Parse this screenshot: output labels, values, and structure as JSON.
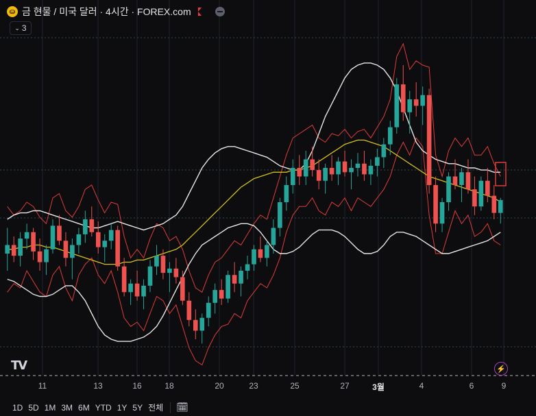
{
  "header": {
    "symbol_icon": "gold-coin-icon",
    "title": "금 현물 / 미국 달러 · 4시간 · FOREX.com",
    "indicator_count": "3"
  },
  "colors": {
    "background": "#0d0d0f",
    "up": "#26a69a",
    "down": "#ef5350",
    "bollinger": "#e8e8e8",
    "ma": "#d4c21c",
    "envelope": "#e03c3c",
    "grid": "#1f2330"
  },
  "x_axis_labels": [
    "11",
    "13",
    "16",
    "18",
    "20",
    "23",
    "25",
    "27",
    "3월",
    "4",
    "6",
    "9"
  ],
  "range_buttons": [
    "1D",
    "5D",
    "1M",
    "3M",
    "6M",
    "YTD",
    "1Y",
    "5Y",
    "전체"
  ],
  "icons": {
    "tradingview": "tradingview-logo-icon",
    "bolt": "lightning-icon",
    "calendar": "calendar-range-icon"
  },
  "chart_data": {
    "type": "candlestick",
    "candles": [
      [
        48,
        60,
        40,
        52
      ],
      [
        52,
        56,
        44,
        47
      ],
      [
        47,
        58,
        42,
        55
      ],
      [
        55,
        62,
        50,
        58
      ],
      [
        58,
        60,
        45,
        49
      ],
      [
        49,
        55,
        40,
        44
      ],
      [
        44,
        52,
        38,
        50
      ],
      [
        50,
        64,
        48,
        61
      ],
      [
        61,
        66,
        52,
        54
      ],
      [
        54,
        58,
        42,
        46
      ],
      [
        46,
        55,
        36,
        52
      ],
      [
        52,
        60,
        48,
        57
      ],
      [
        57,
        68,
        53,
        64
      ],
      [
        64,
        70,
        56,
        58
      ],
      [
        58,
        63,
        48,
        51
      ],
      [
        51,
        57,
        44,
        54
      ],
      [
        54,
        62,
        50,
        59
      ],
      [
        59,
        61,
        40,
        42
      ],
      [
        42,
        46,
        28,
        30
      ],
      [
        30,
        36,
        24,
        34
      ],
      [
        34,
        40,
        26,
        28
      ],
      [
        28,
        36,
        22,
        33
      ],
      [
        33,
        45,
        30,
        42
      ],
      [
        42,
        52,
        38,
        47
      ],
      [
        47,
        50,
        36,
        39
      ],
      [
        39,
        44,
        30,
        41
      ],
      [
        41,
        46,
        34,
        37
      ],
      [
        37,
        40,
        24,
        26
      ],
      [
        26,
        30,
        14,
        17
      ],
      [
        17,
        22,
        8,
        12
      ],
      [
        12,
        20,
        6,
        18
      ],
      [
        18,
        28,
        14,
        25
      ],
      [
        25,
        34,
        20,
        31
      ],
      [
        31,
        36,
        24,
        27
      ],
      [
        27,
        40,
        25,
        38
      ],
      [
        38,
        44,
        30,
        34
      ],
      [
        34,
        42,
        28,
        40
      ],
      [
        40,
        47,
        36,
        43
      ],
      [
        43,
        52,
        40,
        50
      ],
      [
        50,
        56,
        44,
        46
      ],
      [
        46,
        54,
        42,
        52
      ],
      [
        52,
        64,
        48,
        60
      ],
      [
        60,
        74,
        56,
        72
      ],
      [
        72,
        84,
        68,
        80
      ],
      [
        80,
        92,
        76,
        88
      ],
      [
        88,
        94,
        80,
        84
      ],
      [
        84,
        96,
        80,
        92
      ],
      [
        92,
        98,
        84,
        87
      ],
      [
        87,
        92,
        78,
        82
      ],
      [
        82,
        90,
        76,
        88
      ],
      [
        88,
        94,
        82,
        85
      ],
      [
        85,
        93,
        80,
        91
      ],
      [
        91,
        96,
        84,
        86
      ],
      [
        86,
        92,
        78,
        88
      ],
      [
        88,
        95,
        84,
        90
      ],
      [
        90,
        96,
        82,
        85
      ],
      [
        85,
        92,
        80,
        89
      ],
      [
        89,
        97,
        84,
        93
      ],
      [
        93,
        102,
        88,
        99
      ],
      [
        99,
        110,
        94,
        107
      ],
      [
        107,
        130,
        104,
        127
      ],
      [
        127,
        136,
        110,
        114
      ],
      [
        114,
        124,
        104,
        120
      ],
      [
        120,
        128,
        112,
        117
      ],
      [
        117,
        126,
        108,
        122
      ],
      [
        122,
        125,
        76,
        80
      ],
      [
        80,
        84,
        58,
        62
      ],
      [
        62,
        74,
        58,
        72
      ],
      [
        72,
        86,
        68,
        84
      ],
      [
        84,
        92,
        78,
        80
      ],
      [
        80,
        88,
        72,
        86
      ],
      [
        86,
        92,
        76,
        78
      ],
      [
        78,
        84,
        66,
        70
      ],
      [
        70,
        84,
        68,
        82
      ],
      [
        82,
        88,
        72,
        75
      ],
      [
        75,
        80,
        64,
        67
      ],
      [
        67,
        74,
        62,
        73
      ]
    ],
    "bollinger_upper": [
      64,
      66,
      67,
      67,
      68,
      68,
      67,
      66,
      65,
      64,
      63,
      62,
      61,
      60,
      60,
      61,
      62,
      63,
      62,
      61,
      60,
      59,
      60,
      61,
      62,
      64,
      66,
      70,
      76,
      82,
      88,
      92,
      95,
      97,
      98,
      98,
      97,
      96,
      95,
      94,
      93,
      91,
      89,
      88,
      87,
      87,
      90,
      96,
      104,
      112,
      118,
      124,
      130,
      134,
      136,
      137,
      137,
      136,
      134,
      130,
      124,
      116,
      108,
      100,
      96,
      94,
      92,
      91,
      90,
      90,
      89,
      88,
      88,
      87,
      87,
      86,
      86
    ],
    "bollinger_lower": [
      36,
      35,
      33,
      31,
      29,
      28,
      28,
      29,
      31,
      33,
      33,
      30,
      26,
      20,
      14,
      10,
      8,
      7,
      7,
      7,
      8,
      9,
      11,
      14,
      19,
      25,
      31,
      37,
      43,
      48,
      52,
      54,
      56,
      58,
      60,
      61,
      62,
      62,
      61,
      58,
      54,
      50,
      48,
      48,
      49,
      51,
      54,
      57,
      59,
      59,
      59,
      58,
      56,
      53,
      50,
      48,
      48,
      49,
      52,
      56,
      58,
      58,
      57,
      56,
      54,
      52,
      50,
      48,
      48,
      49,
      50,
      51,
      52,
      53,
      54,
      56,
      58
    ],
    "moving_average": [
      50,
      50,
      51,
      51,
      52,
      52,
      51,
      51,
      50,
      49,
      48,
      47,
      46,
      45,
      44,
      43,
      43,
      43,
      44,
      44,
      45,
      45,
      46,
      47,
      48,
      49,
      50,
      52,
      55,
      58,
      61,
      64,
      67,
      70,
      73,
      76,
      79,
      81,
      83,
      84,
      85,
      86,
      86,
      86,
      87,
      87,
      88,
      89,
      91,
      93,
      95,
      97,
      99,
      100,
      101,
      101,
      100,
      99,
      98,
      96,
      94,
      92,
      90,
      88,
      86,
      84,
      83,
      82,
      81,
      80,
      79,
      78,
      77,
      76,
      75,
      74,
      72
    ],
    "y_range": [
      0,
      160
    ]
  }
}
